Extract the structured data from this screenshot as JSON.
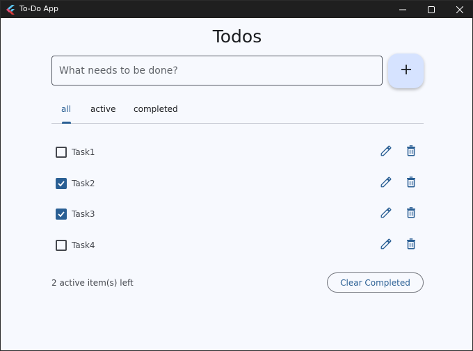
{
  "window": {
    "title": "To-Do App",
    "icons": {
      "app": "flutter-logo-icon",
      "minimize": "minimize-icon",
      "maximize": "maximize-icon",
      "close": "close-icon"
    }
  },
  "heading": "Todos",
  "new_todo": {
    "placeholder": "What needs to be done?",
    "value": "",
    "add_icon": "plus-icon"
  },
  "tabs": [
    {
      "label": "all",
      "selected": true
    },
    {
      "label": "active",
      "selected": false
    },
    {
      "label": "completed",
      "selected": false
    }
  ],
  "todos": [
    {
      "label": "Task1",
      "completed": false
    },
    {
      "label": "Task2",
      "completed": true
    },
    {
      "label": "Task3",
      "completed": true
    },
    {
      "label": "Task4",
      "completed": false
    }
  ],
  "footer": {
    "items_left": "2 active item(s) left",
    "clear_label": "Clear Completed"
  },
  "colors": {
    "accent": "#2a5f94",
    "background": "#f7f9fe",
    "fab": "#d6e3ff",
    "titlebar": "#1f1f1f"
  }
}
